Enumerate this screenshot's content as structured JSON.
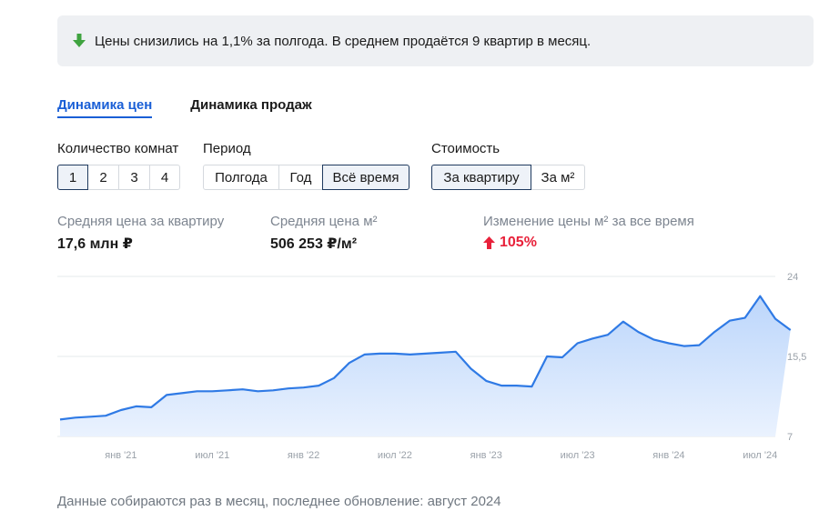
{
  "banner": {
    "text": "Цены снизились на 1,1% за полгода. В среднем продаётся 9 квартир в месяц.",
    "icon": "arrow-down-icon",
    "icon_color": "#3fa33f"
  },
  "tabs": [
    {
      "label": "Динамика цен",
      "active": true
    },
    {
      "label": "Динамика продаж",
      "active": false
    }
  ],
  "filters": {
    "rooms": {
      "label": "Количество комнат",
      "options": [
        "1",
        "2",
        "3",
        "4"
      ],
      "selected": "1"
    },
    "period": {
      "label": "Период",
      "options": [
        "Полгода",
        "Год",
        "Всё время"
      ],
      "selected": "Всё время"
    },
    "cost": {
      "label": "Стоимость",
      "options": [
        "За квартиру",
        "За м²"
      ],
      "selected": "За квартиру"
    }
  },
  "stats": {
    "avg_price_label": "Средняя цена за квартиру",
    "avg_price_value": "17,6 млн ₽",
    "avg_m2_label": "Средняя цена м²",
    "avg_m2_value": "506 253 ₽/м²",
    "change_label": "Изменение цены м² за все время",
    "change_value": "105%",
    "change_color": "#e8213a"
  },
  "chart_data": {
    "type": "area",
    "x": [
      "2020-09",
      "2020-10",
      "2020-11",
      "2020-12",
      "2021-01",
      "2021-02",
      "2021-03",
      "2021-04",
      "2021-05",
      "2021-06",
      "2021-07",
      "2021-08",
      "2021-09",
      "2021-10",
      "2021-11",
      "2021-12",
      "2022-01",
      "2022-02",
      "2022-03",
      "2022-04",
      "2022-05",
      "2022-06",
      "2022-07",
      "2022-08",
      "2022-09",
      "2022-10",
      "2022-11",
      "2022-12",
      "2023-01",
      "2023-02",
      "2023-03",
      "2023-04",
      "2023-05",
      "2023-06",
      "2023-07",
      "2023-08",
      "2023-09",
      "2023-10",
      "2023-11",
      "2023-12",
      "2024-01",
      "2024-02",
      "2024-03",
      "2024-04",
      "2024-05",
      "2024-06",
      "2024-07",
      "2024-08"
    ],
    "y": [
      8.8,
      9.0,
      9.1,
      9.2,
      9.8,
      10.2,
      10.1,
      11.4,
      11.6,
      11.8,
      11.8,
      11.9,
      12.0,
      11.8,
      11.9,
      12.1,
      12.2,
      12.4,
      13.2,
      14.8,
      15.7,
      15.8,
      15.8,
      15.7,
      15.8,
      15.9,
      16.0,
      14.2,
      12.9,
      12.4,
      12.4,
      12.3,
      15.5,
      15.4,
      16.9,
      17.4,
      17.8,
      19.2,
      18.1,
      17.3,
      16.9,
      16.6,
      16.7,
      18.1,
      19.3,
      19.6,
      21.9,
      19.5,
      18.3
    ],
    "yticks": [
      "24",
      "15,5",
      "7"
    ],
    "ylim": [
      7,
      24
    ],
    "xticks": [
      {
        "label": "янв '21",
        "x": "2021-01"
      },
      {
        "label": "июл '21",
        "x": "2021-07"
      },
      {
        "label": "янв '22",
        "x": "2022-01"
      },
      {
        "label": "июл '22",
        "x": "2022-07"
      },
      {
        "label": "янв '23",
        "x": "2023-01"
      },
      {
        "label": "июл '23",
        "x": "2023-07"
      },
      {
        "label": "янв '24",
        "x": "2024-01"
      },
      {
        "label": "июл '24",
        "x": "2024-07"
      }
    ],
    "line_color": "#2f7ae5",
    "fill_top": "#bcd6fb",
    "fill_bottom": "#eaf2fe",
    "grid": true
  },
  "footer": "Данные собираются раз в месяц, последнее обновление: август 2024"
}
